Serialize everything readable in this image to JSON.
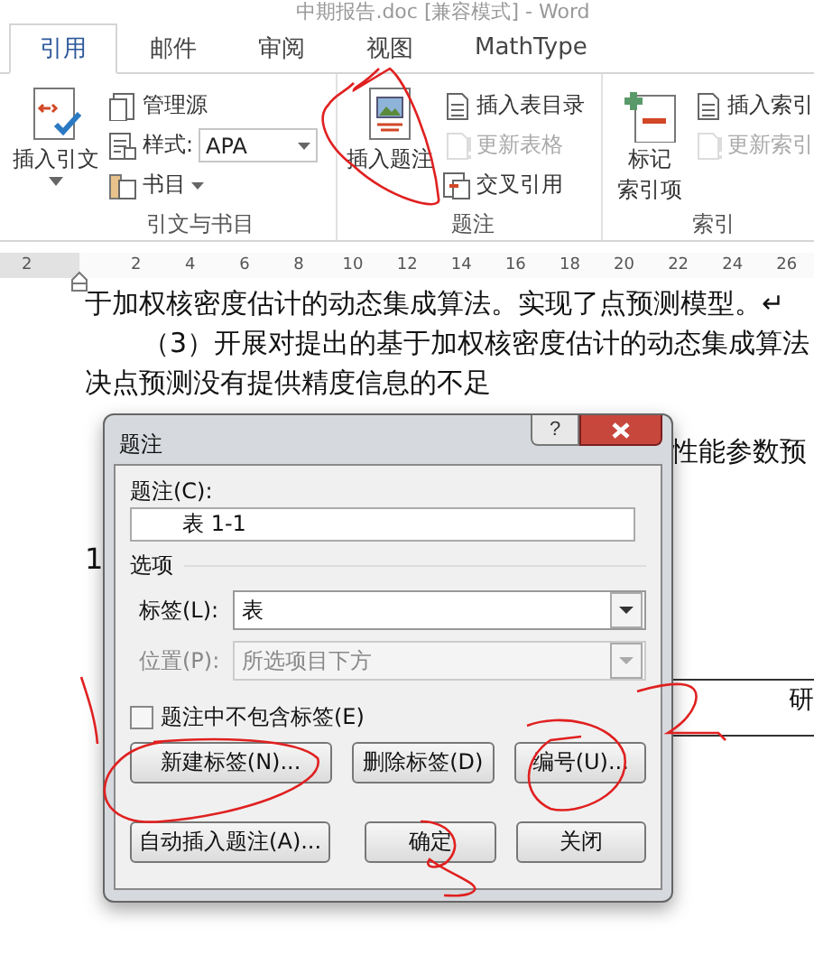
{
  "window": {
    "title": "中期报告.doc [兼容模式] - Word"
  },
  "tabs": [
    {
      "label": "引用",
      "selected": true
    },
    {
      "label": "邮件",
      "selected": false
    },
    {
      "label": "审阅",
      "selected": false
    },
    {
      "label": "视图",
      "selected": false
    },
    {
      "label": "MathType",
      "selected": false
    }
  ],
  "ribbon": {
    "groups": [
      {
        "label": "引文与书目",
        "large_buttons": [
          {
            "lines": [
              "插入引文"
            ],
            "dropdown": true
          }
        ],
        "small_buttons": [
          {
            "kind": "button",
            "label": "管理源",
            "disabled": false,
            "dropdown": false
          },
          {
            "kind": "dropdown",
            "label": "样式:",
            "value": "APA"
          },
          {
            "kind": "button",
            "label": "书目",
            "disabled": false,
            "dropdown": true
          }
        ]
      },
      {
        "label": "题注",
        "large_buttons": [
          {
            "lines": [
              "插入题注"
            ],
            "dropdown": false
          }
        ],
        "small_buttons": [
          {
            "kind": "button",
            "label": "插入表目录",
            "disabled": false,
            "dropdown": false
          },
          {
            "kind": "button",
            "label": "更新表格",
            "disabled": true,
            "dropdown": false
          },
          {
            "kind": "button",
            "label": "交叉引用",
            "disabled": false,
            "dropdown": false
          }
        ]
      },
      {
        "label": "索引",
        "large_buttons": [
          {
            "lines": [
              "标记",
              "索引项"
            ],
            "dropdown": false
          }
        ],
        "small_buttons": [
          {
            "kind": "button",
            "label": "插入索引",
            "disabled": false,
            "dropdown": false
          },
          {
            "kind": "button",
            "label": "更新索引",
            "disabled": true,
            "dropdown": false
          }
        ]
      }
    ]
  },
  "ruler": {
    "marks": [
      "2",
      "2",
      "4",
      "6",
      "8",
      "10",
      "12",
      "14",
      "16",
      "18",
      "20",
      "22",
      "24",
      "26"
    ]
  },
  "document": {
    "paragraphs": [
      {
        "text": "于加权核密度估计的动态集成算法。实现了点预测模型。↵",
        "first_line_indent": false
      },
      {
        "text": "（3）开展对提出的基于加权核密度估计的动态集成算法",
        "first_line_indent": true
      },
      {
        "text": "决点预测没有提供精度信息的不足",
        "first_line_indent": false
      }
    ],
    "side_text": "性能参数预",
    "number": "1",
    "table_cell": "研"
  },
  "dialog": {
    "title": "题注",
    "help": "?",
    "caption_label": "题注(C):",
    "caption_value": "表 1-1",
    "options_heading": "选项",
    "fields": [
      {
        "label": "标签(L):",
        "value": "表",
        "disabled": false
      },
      {
        "label": "位置(P):",
        "value": "所选项目下方",
        "disabled": true
      }
    ],
    "checkbox": {
      "label": "题注中不包含标签(E)",
      "checked": false
    },
    "button_rows": [
      [
        "新建标签(N)...",
        "删除标签(D)",
        "编号(U)..."
      ],
      [
        "自动插入题注(A)...",
        "确定",
        "关闭"
      ]
    ]
  }
}
